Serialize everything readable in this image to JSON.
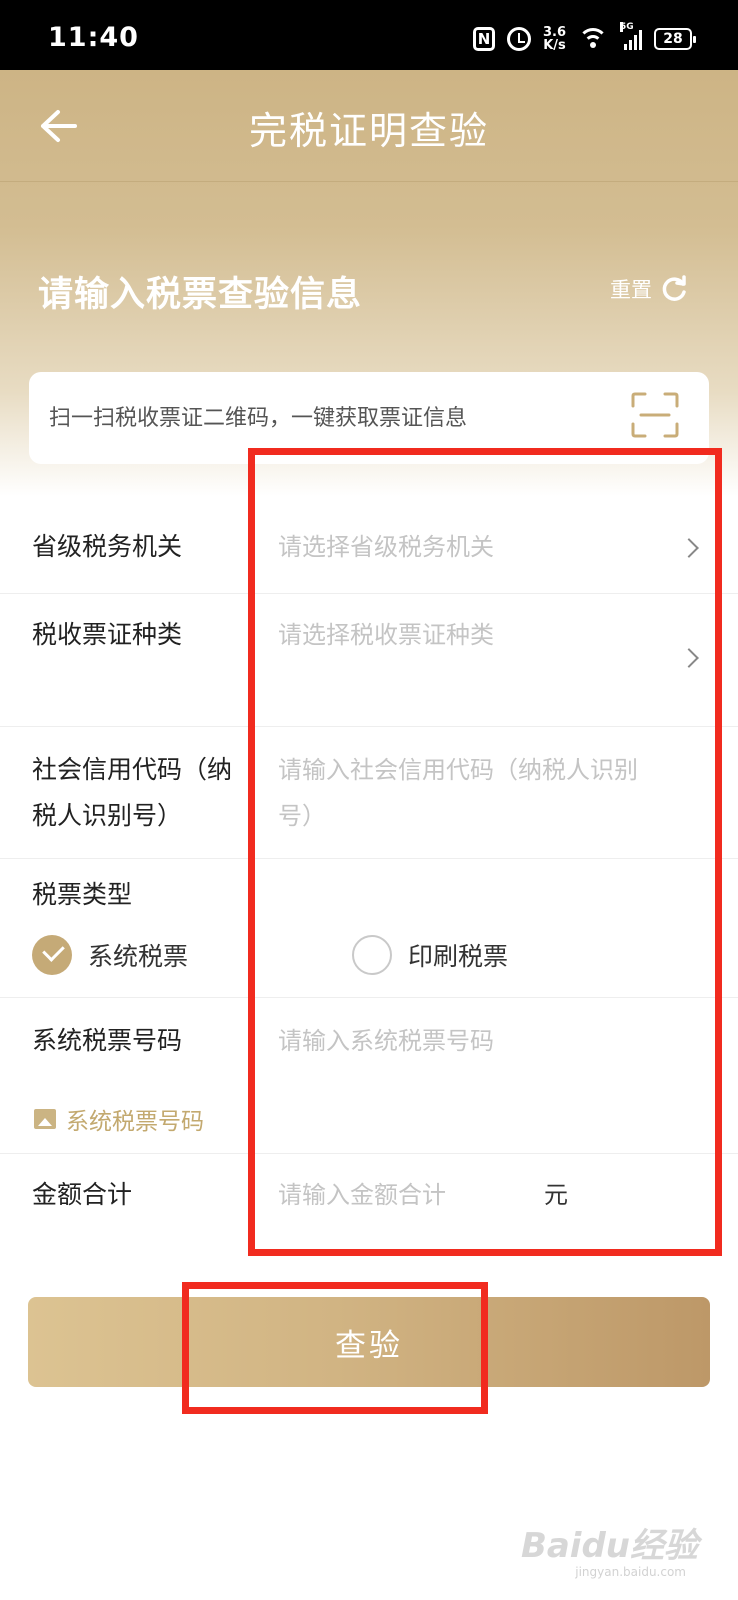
{
  "status_bar": {
    "time": "11:40",
    "nfc": "N",
    "net_speed_value": "3.6",
    "net_speed_unit": "K/s",
    "network": "5G",
    "battery": "28"
  },
  "header": {
    "title": "完税证明查验",
    "section_title": "请输入税票查验信息",
    "reset_label": "重置"
  },
  "scan": {
    "text": "扫一扫税收票证二维码，一键获取票证信息"
  },
  "form": {
    "tax_authority": {
      "label": "省级税务机关",
      "placeholder": "请选择省级税务机关"
    },
    "voucher_type": {
      "label": "税收票证种类",
      "placeholder": "请选择税收票证种类"
    },
    "credit_code": {
      "label_line1": "社会信用代码（纳",
      "label_line2": "税人识别号）",
      "placeholder_line1": "请输入社会信用代码（纳税人识别",
      "placeholder_line2": "号）"
    },
    "ticket_type": {
      "label": "税票类型",
      "options": [
        {
          "label": "系统税票",
          "checked": true
        },
        {
          "label": "印刷税票",
          "checked": false
        }
      ]
    },
    "ticket_number": {
      "label": "系统税票号码",
      "placeholder": "请输入系统税票号码",
      "image_link": "系统税票号码"
    },
    "amount": {
      "label": "金额合计",
      "placeholder": "请输入金额合计",
      "unit": "元"
    }
  },
  "submit_label": "查验",
  "watermark": {
    "brand": "Baidu经验",
    "url": "jingyan.baidu.com"
  },
  "colors": {
    "accent": "#c5aa77",
    "annotation": "#f12b1f",
    "placeholder": "#c4c4c4"
  }
}
